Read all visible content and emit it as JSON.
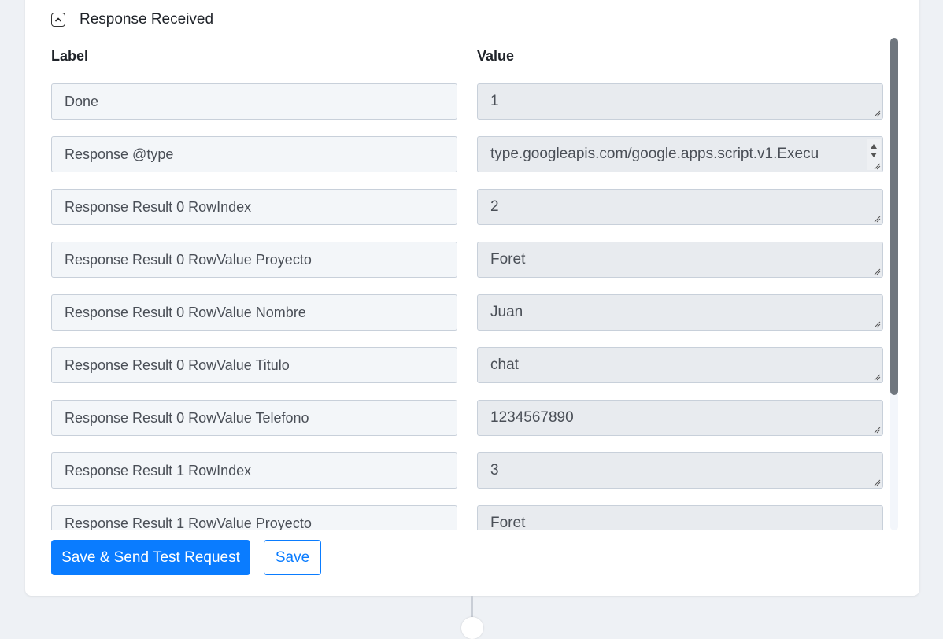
{
  "section": {
    "title": "Response Received"
  },
  "columns": {
    "label": "Label",
    "value": "Value"
  },
  "rows": [
    {
      "label": "Done",
      "value": "1"
    },
    {
      "label": "Response @type",
      "value": "type.googleapis.com/google.apps.script.v1.Execu"
    },
    {
      "label": "Response Result 0 RowIndex",
      "value": "2"
    },
    {
      "label": "Response Result 0 RowValue Proyecto",
      "value": "Foret"
    },
    {
      "label": "Response Result 0 RowValue Nombre",
      "value": "Juan"
    },
    {
      "label": "Response Result 0 RowValue Titulo",
      "value": "chat"
    },
    {
      "label": "Response Result 0 RowValue Telefono",
      "value": "1234567890"
    },
    {
      "label": "Response Result 1 RowIndex",
      "value": "3"
    },
    {
      "label": "Response Result 1 RowValue Proyecto",
      "value": "Foret"
    }
  ],
  "buttons": {
    "save_send": "Save & Send Test Request",
    "save": "Save"
  },
  "colors": {
    "accent": "#0a7cff",
    "label_bg": "#f3f6f9",
    "value_bg": "#e8ebef",
    "border": "#c8d0da"
  },
  "icons": {
    "toggle": "chevron-up-icon",
    "grip": "resize-grip-icon"
  }
}
